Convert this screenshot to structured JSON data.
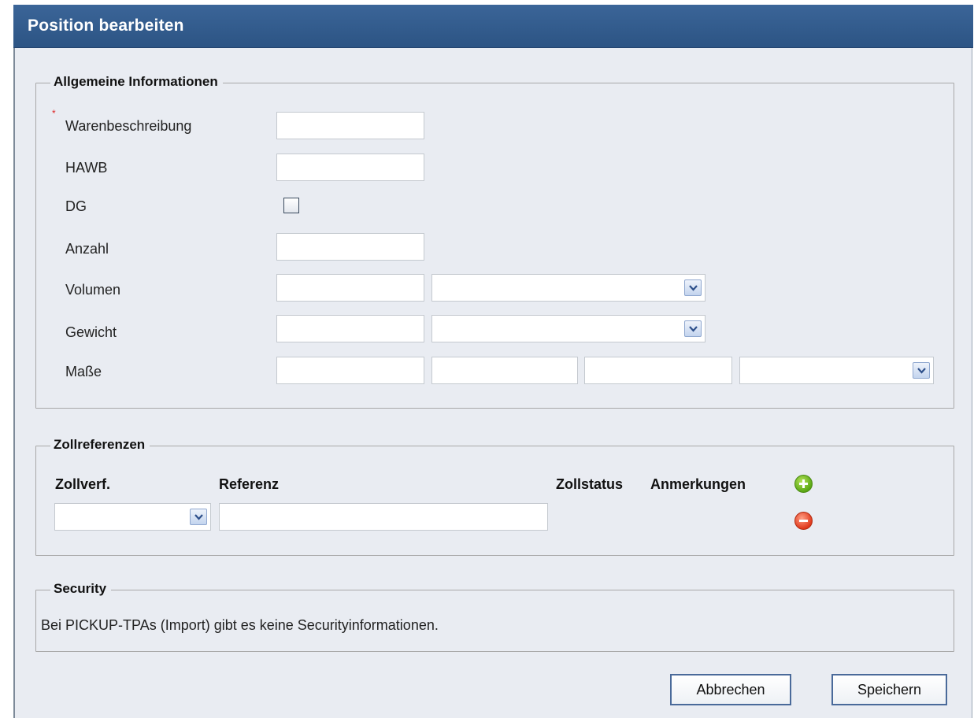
{
  "dialog": {
    "title": "Position bearbeiten"
  },
  "general": {
    "legend": "Allgemeine Informationen",
    "required_mark": "*",
    "labels": {
      "warenbeschreibung": "Warenbeschreibung",
      "hawb": "HAWB",
      "dg": "DG",
      "anzahl": "Anzahl",
      "volumen": "Volumen",
      "gewicht": "Gewicht",
      "masse": "Maße"
    },
    "values": {
      "warenbeschreibung": "",
      "hawb": "",
      "anzahl": "",
      "volumen": "",
      "volumen_unit": "",
      "gewicht": "",
      "gewicht_unit": "",
      "masse_length": "",
      "masse_width": "",
      "masse_height": "",
      "masse_unit": ""
    },
    "dg_checked": false
  },
  "customs": {
    "legend": "Zollreferenzen",
    "columns": {
      "zollverf": "Zollverf.",
      "referenz": "Referenz",
      "zollstatus": "Zollstatus",
      "anmerkungen": "Anmerkungen"
    },
    "row": {
      "zollverf": "",
      "referenz": ""
    },
    "add_icon": "plus-circle-green",
    "remove_icon": "minus-circle-red"
  },
  "security": {
    "legend": "Security",
    "text": "Bei PICKUP-TPAs (Import) gibt es keine Securityinformationen."
  },
  "actions": {
    "cancel": "Abbrechen",
    "save": "Speichern"
  },
  "colors": {
    "titlebar": "#2f5889",
    "panel_bg": "#e9ecf2",
    "add": "#5aa714",
    "remove": "#e0391c"
  }
}
